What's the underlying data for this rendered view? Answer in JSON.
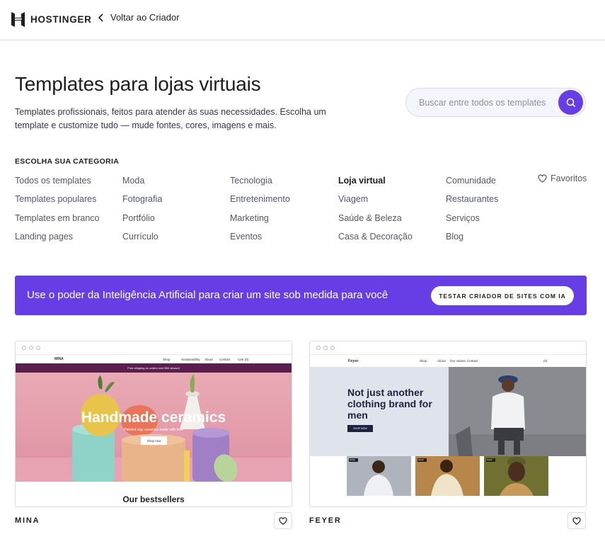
{
  "header": {
    "brand": "HOSTINGER",
    "back_label": "Voltar ao Criador"
  },
  "hero": {
    "title": "Templates para lojas virtuais",
    "subtitle": "Templates profissionais, feitos para atender às suas necessidades. Escolha um template e customize tudo — mude fontes, cores, imagens e mais.",
    "search_placeholder": "Buscar entre todos os templates"
  },
  "categories": {
    "heading": "ESCOLHA SUA CATEGORIA",
    "columns": [
      [
        "Todos os templates",
        "Templates populares",
        "Templates em branco",
        "Landing pages"
      ],
      [
        "Moda",
        "Fotografia",
        "Portfólio",
        "Currículo"
      ],
      [
        "Tecnologia",
        "Entretenimento",
        "Marketing",
        "Eventos"
      ],
      [
        "Loja virtual",
        "Viagem",
        "Saúde & Beleza",
        "Casa & Decoração"
      ],
      [
        "Comunidade",
        "Restaurantes",
        "Serviços",
        "Blog"
      ]
    ],
    "active": "Loja virtual",
    "favorites_label": "Favoritos"
  },
  "banner": {
    "text": "Use o poder da Inteligência Artificial para criar um site sob medida para você",
    "button_label": "TESTAR CRIADOR DE SITES COM IA"
  },
  "templates": [
    {
      "name": "MINA",
      "preview": {
        "brand": "MINA",
        "nav": [
          "Shop",
          "Sustainability",
          "About",
          "Contact",
          "Cart (0)"
        ],
        "promo": "Free shipping on orders over $50 amount",
        "hero_title": "Handmade ceramics",
        "hero_sub": "Painted clay ceramics made with love",
        "hero_button": "Shop now",
        "section_title": "Our bestsellers"
      }
    },
    {
      "name": "FEYER",
      "preview": {
        "brand": "Feyer",
        "nav": [
          "Shop",
          "About",
          "Our values",
          "Contact"
        ],
        "cart": "(0)",
        "hero_title": "Not just another clothing brand for men",
        "hero_button": "SHOP NOW",
        "tile_badge": "SALE"
      }
    }
  ],
  "colors": {
    "accent": "#673de6",
    "text": "#1d1e20",
    "muted": "#55576b",
    "border": "#dadce0"
  }
}
